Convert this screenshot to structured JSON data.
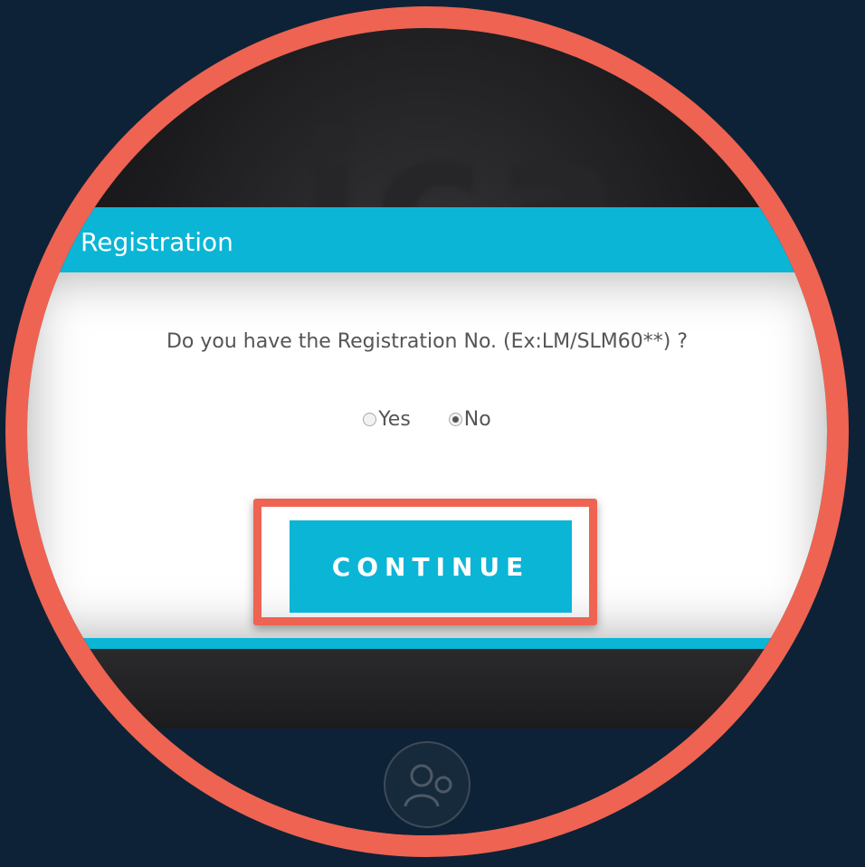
{
  "modal": {
    "title": "ew Registration",
    "question": "Do you have the Registration No. (Ex:LM/SLM60**) ?",
    "options": [
      {
        "label": "Yes",
        "checked": false
      },
      {
        "label": "No",
        "checked": true
      }
    ],
    "continue_label": "CONTINUE"
  },
  "icons": {
    "radio_yes": "radio-unchecked-icon",
    "radio_no": "radio-checked-icon",
    "avatar": "doctor-avatar-icon"
  },
  "colors": {
    "accent": "#0bb5d6",
    "highlight": "#ef6352",
    "background": "#0d2236"
  }
}
